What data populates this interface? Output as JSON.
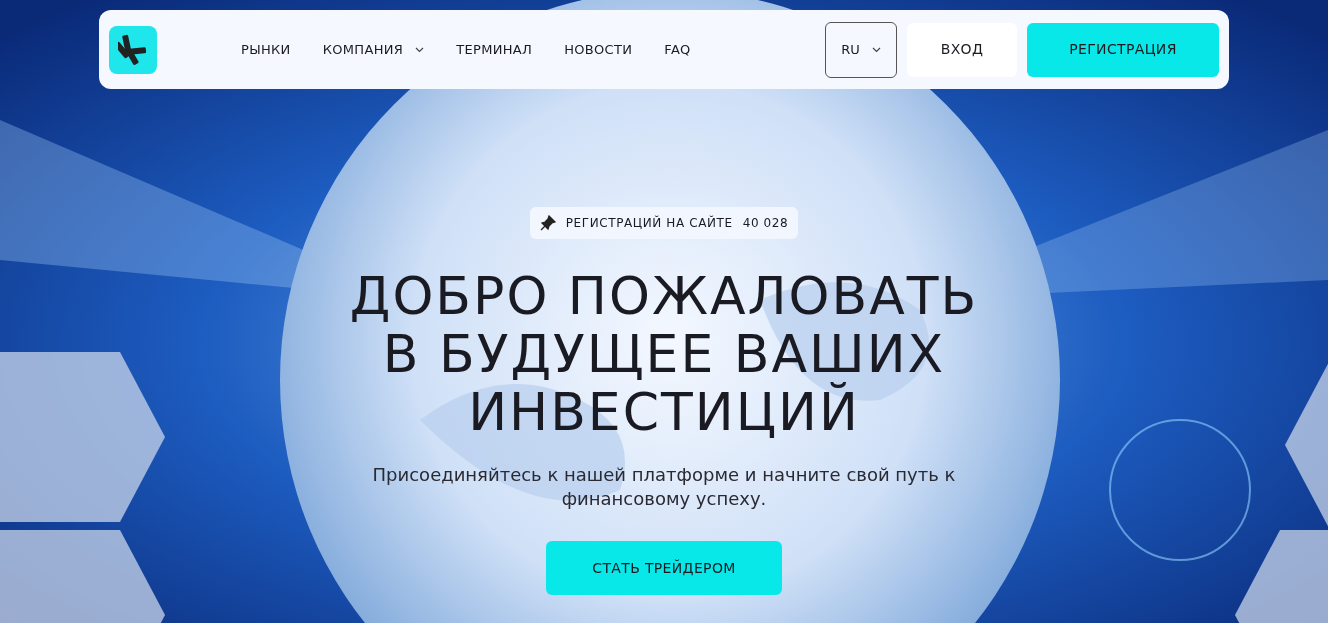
{
  "header": {
    "nav": [
      {
        "label": "РЫНКИ",
        "kind": "link"
      },
      {
        "label": "КОМПАНИЯ",
        "kind": "dropdown"
      },
      {
        "label": "ТЕРМИНАЛ",
        "kind": "link"
      },
      {
        "label": "НОВОСТИ",
        "kind": "link"
      },
      {
        "label": "FAQ",
        "kind": "link"
      }
    ],
    "language": "RU",
    "login": "ВХОД",
    "register": "РЕГИСТРАЦИЯ"
  },
  "hero": {
    "badge": {
      "label": "РЕГИСТРАЦИЙ НА САЙТЕ",
      "count": "40 028"
    },
    "title_lines": [
      "ДОБРО ПОЖАЛОВАТЬ",
      "В БУДУЩЕЕ ВАШИХ",
      "ИНВЕСТИЦИЙ"
    ],
    "subtitle": "Присоединяйтесь к нашей платформе и начните свой путь к финансовому успеху.",
    "cta": "СТАТЬ ТРЕЙДЕРОМ"
  }
}
